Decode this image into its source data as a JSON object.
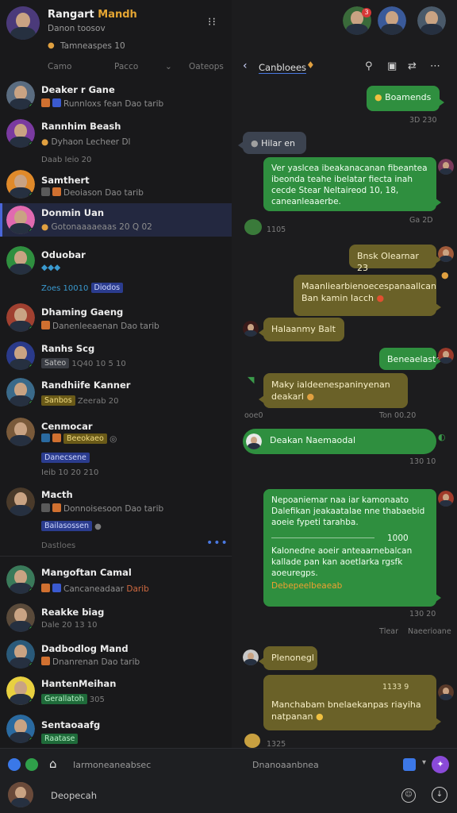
{
  "me": {
    "name": "Rangart",
    "name_accent": "Mandh",
    "status": "Danon toosov",
    "sub": "Tamneaspes 10"
  },
  "filters": [
    "Camo",
    "Pacco",
    "⌄",
    "Oateops"
  ],
  "chats": [
    {
      "name": "Deaker r Gane",
      "preview": "Runnloxs fean Dao",
      "meta": "tarib",
      "color": "#5a6c80"
    },
    {
      "name": "Rannhim Beash",
      "preview": "Dyhaon Lecheer",
      "meta": "Dl",
      "meta2": "Daab",
      "meta3": "Ieio 20",
      "color": "#7a3aa0"
    },
    {
      "name": "Samthert",
      "preview": "Deoiason Dao",
      "meta": "tarib",
      "color": "#e08a2a"
    },
    {
      "name": "Donmin Uan",
      "preview": "Gotonaaaaeaas",
      "meta": "20 Q",
      "meta2": "02",
      "color": "#e06ab0"
    },
    {
      "name": "Oduobar",
      "preview": "",
      "meta": "Zoes 10010",
      "pill": "Diodos",
      "color": "#2f8f3f"
    },
    {
      "name": "Dhaming Gaeng",
      "preview": "Danenleeaenan Dao",
      "meta": "tarib",
      "color": "#a04030"
    },
    {
      "name": "Ranhs Scg",
      "preview": "",
      "meta": "1Q40 10 5 10",
      "pill": "Sateo",
      "color": "#2a3a8a"
    },
    {
      "name": "Randhiife Kanner",
      "preview": "",
      "meta": "Zeerab",
      "meta2": "20",
      "pill": "Sanbos",
      "color": "#3a6a8a"
    },
    {
      "name": "Cenmocar",
      "preview": "",
      "meta": "",
      "pill": "Beeokaeo",
      "pill2": "Danecsene",
      "meta3": "Ieib 10 20 210",
      "color": "#7a5a3a"
    },
    {
      "name": "Macth",
      "preview": "Donnoisesoon Dao",
      "meta": "tarib",
      "pill": "Bailasossen",
      "color": "#4a3a2a"
    },
    {
      "name": "Mangoftan Camal",
      "preview": "Cancaneadaar",
      "meta": "Darib",
      "color": "#3a7a5a"
    },
    {
      "name": "Reakke biag",
      "preview": "",
      "meta": "Dale 20 13 10",
      "color": "#5a4a3a"
    },
    {
      "name": "Dadbodlog Mand",
      "preview": "Dnanrenan Dao",
      "meta": "tarib",
      "color": "#2a5a7a"
    },
    {
      "name": "HantenMeihan",
      "preview": "",
      "meta": "305",
      "pill": "Gerallatoh",
      "color": "#e8d040"
    },
    {
      "name": "Sentaoaafg",
      "preview": "",
      "meta": "",
      "pill": "Raatase",
      "color": "#2a6aa0"
    }
  ],
  "left_more": "Dastloes",
  "conversation": {
    "title": "Canbloees",
    "messages": [
      {
        "text": "Boamends",
        "time": "3D 230"
      },
      {
        "text": "Hilar en"
      },
      {
        "text": "Ver yaslcea ibeakanacanan fibeantea ibeonda teahe ibelatar fiecta inah cecde Stear Neltaireod 10, 18, caneanleaaerbe.",
        "time": "Ga 2D"
      },
      {
        "time": "1105"
      },
      {
        "text": "Bnsk Olearnar 23"
      },
      {
        "text": "Maanliearbienoecespanaallcan Ban kamin Iacch"
      },
      {
        "text": "Halaanmy Balt"
      },
      {
        "text": "Beneaelaste"
      },
      {
        "text": "Maky ialdeenespaninyenan deakarl",
        "time": "Ton 00.20"
      },
      {
        "time": "ooe0"
      },
      {
        "text": "Deakan Naemaodal",
        "time": "130 10"
      },
      {
        "text": "Nepoaniemar naa iar kamonaato Dalefikan jeakaatalae nne thabaebid aoeie fypeti tarahba.",
        "text2": "Kalonedne aoeir anteaarnebalcan kallade pan kan aoetlarka rgsfk aoeuregps.",
        "divider_label": "1000",
        "highlight": "Debepeelbeaeab",
        "time": "130 20"
      },
      {
        "text": "Naeerioane",
        "time2": "Tlear"
      },
      {
        "text": "Plenonegl"
      },
      {
        "text": "Manchabam bnelaekanpas riayiha natpanan",
        "time": "1133 9"
      },
      {
        "time": "1325"
      }
    ]
  },
  "toolbar": {
    "label": "Iarmoneaneabsec",
    "search": "Dnanoaanbnea"
  },
  "compose": {
    "placeholder": "Deopecah"
  },
  "colors": {
    "accent": "#4a78e0",
    "bubble_green": "#2f8f3f",
    "bubble_olive": "#6a6128",
    "online": "#35b24a"
  }
}
